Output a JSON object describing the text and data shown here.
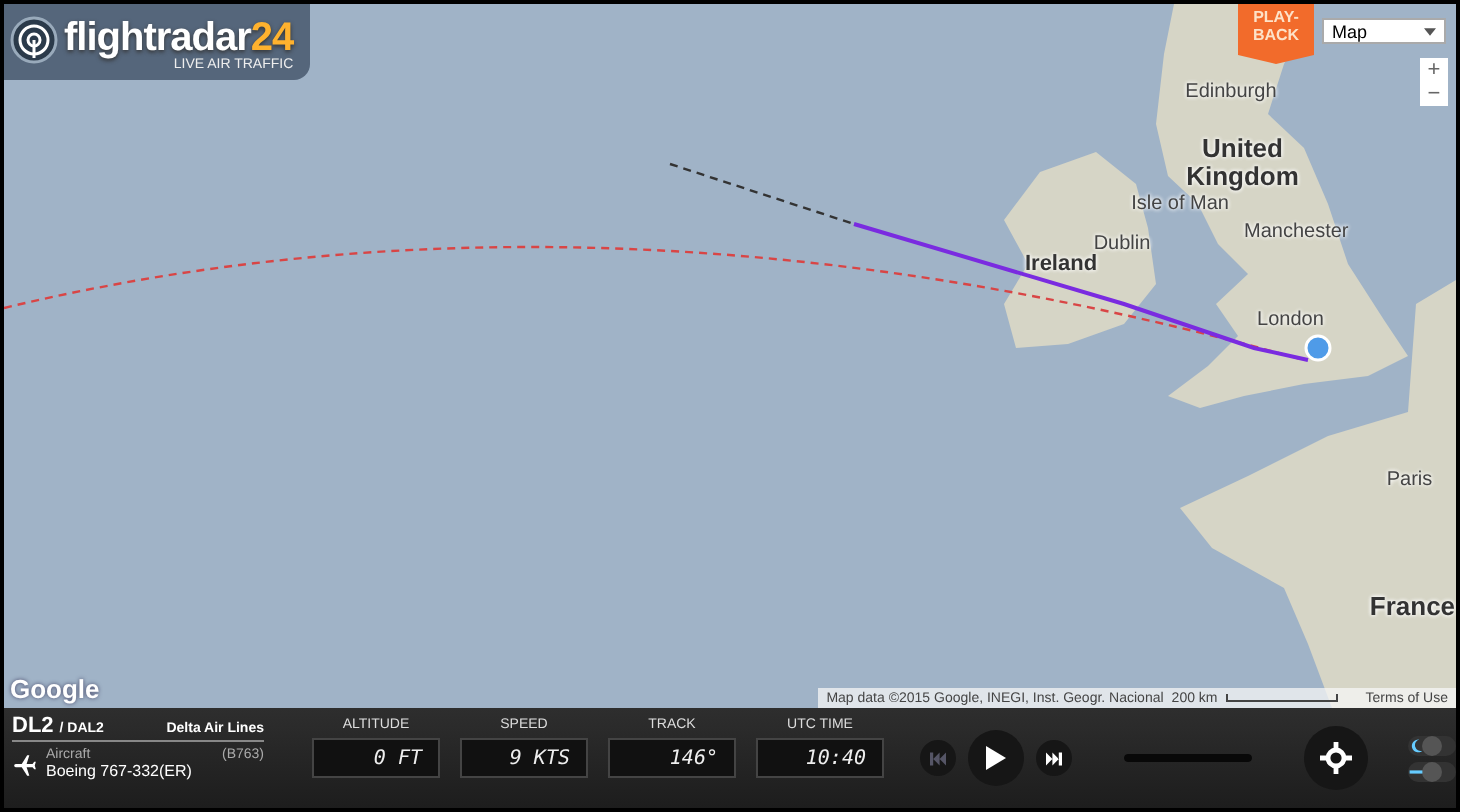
{
  "logo": {
    "name": "flightradar",
    "number": "24",
    "tagline": "LIVE AIR TRAFFIC"
  },
  "playback_button": {
    "lines": [
      "PLAY-",
      "BACK"
    ]
  },
  "map_type": {
    "value": "Map"
  },
  "zoom": {
    "in": "+",
    "out": "−"
  },
  "map_labels": [
    {
      "text": "Edinburgh",
      "kind": "city"
    },
    {
      "text": "United",
      "kind": "country"
    },
    {
      "text": "Kingdom",
      "kind": "country"
    },
    {
      "text": "Isle of Man",
      "kind": "city"
    },
    {
      "text": "Ireland",
      "kind": "country-small"
    },
    {
      "text": "Dublin",
      "kind": "city"
    },
    {
      "text": "Manchester",
      "kind": "city"
    },
    {
      "text": "London",
      "kind": "city"
    },
    {
      "text": "Paris",
      "kind": "city"
    },
    {
      "text": "France",
      "kind": "country"
    }
  ],
  "playback_slider": {
    "level": 1
  },
  "map_footer": {
    "google": "Google",
    "attribution": "Map data ©2015 Google, INEGI, Inst. Geogr. Nacional",
    "scale": "200 km",
    "terms": "Terms of Use"
  },
  "flight": {
    "callsign": "DL2",
    "icao": "/ DAL2",
    "airline": "Delta Air Lines",
    "aircraft_label": "Aircraft",
    "aircraft_code": "(B763)",
    "aircraft_model": "Boeing 767-332(ER)"
  },
  "readouts": [
    {
      "label": "ALTITUDE",
      "value": "0 FT"
    },
    {
      "label": "SPEED",
      "value": "9 KTS"
    },
    {
      "label": "TRACK",
      "value": "146°"
    },
    {
      "label": "UTC TIME",
      "value": "10:40"
    }
  ],
  "toggles": [
    {
      "kind": "moon",
      "on": false
    },
    {
      "kind": "line",
      "on": false
    }
  ]
}
